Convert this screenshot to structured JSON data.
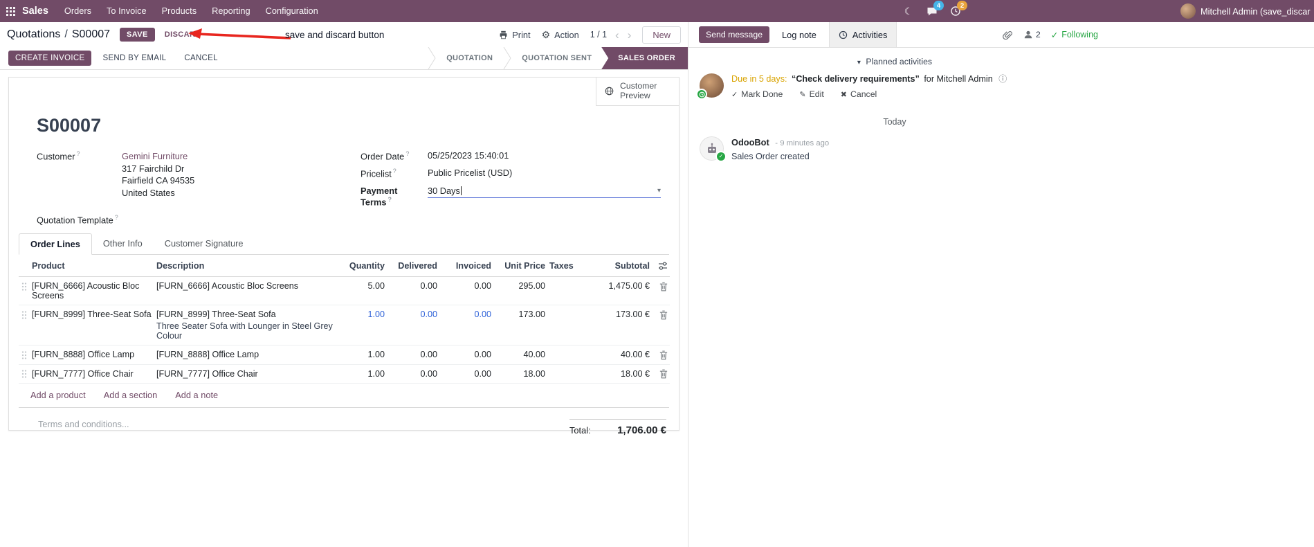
{
  "topbar": {
    "app_name": "Sales",
    "menus": [
      "Orders",
      "To Invoice",
      "Products",
      "Reporting",
      "Configuration"
    ],
    "chat_badge": "4",
    "activity_badge": "2",
    "user_name": "Mitchell Admin (save_discar"
  },
  "control_panel": {
    "breadcrumb_root": "Quotations",
    "breadcrumb_sep": "/",
    "breadcrumb_current": "S00007",
    "save": "SAVE",
    "discard": "DISCARD",
    "print": "Print",
    "action": "Action",
    "pager": "1 / 1",
    "new": "New"
  },
  "annotation": {
    "text": "save and discard button"
  },
  "statusbar": {
    "create_invoice": "CREATE INVOICE",
    "send_by_email": "SEND BY EMAIL",
    "cancel": "CANCEL",
    "stages": [
      "QUOTATION",
      "QUOTATION SENT",
      "SALES ORDER"
    ],
    "active_stage": "SALES ORDER"
  },
  "sheet": {
    "customer_preview": "Customer Preview",
    "title": "S00007",
    "fields": {
      "help_marker": "?",
      "customer_label": "Customer",
      "customer_name": "Gemini Furniture",
      "address_line1": "317 Fairchild Dr",
      "address_line2": "Fairfield CA 94535",
      "address_line3": "United States",
      "quotation_template_label": "Quotation Template",
      "order_date_label": "Order Date",
      "order_date_value": "05/25/2023 15:40:01",
      "pricelist_label": "Pricelist",
      "pricelist_value": "Public Pricelist (USD)",
      "payment_terms_label": "Payment Terms",
      "payment_terms_value": "30 Days"
    },
    "tabs": [
      "Order Lines",
      "Other Info",
      "Customer Signature"
    ],
    "active_tab": "Order Lines",
    "table": {
      "headers": [
        "Product",
        "Description",
        "Quantity",
        "Delivered",
        "Invoiced",
        "Unit Price",
        "Taxes",
        "Subtotal"
      ],
      "rows": [
        {
          "product": "[FURN_6666] Acoustic Bloc Screens",
          "description": "[FURN_6666] Acoustic Bloc Screens",
          "description2": "",
          "quantity": "5.00",
          "delivered": "0.00",
          "invoiced": "0.00",
          "unit_price": "295.00",
          "taxes": "",
          "subtotal": "1,475.00 €",
          "edited": false
        },
        {
          "product": "[FURN_8999] Three-Seat Sofa",
          "description": "[FURN_8999] Three-Seat Sofa",
          "description2": "Three Seater Sofa with Lounger in Steel Grey Colour",
          "quantity": "1.00",
          "delivered": "0.00",
          "invoiced": "0.00",
          "unit_price": "173.00",
          "taxes": "",
          "subtotal": "173.00 €",
          "edited": true
        },
        {
          "product": "[FURN_8888] Office Lamp",
          "description": "[FURN_8888] Office Lamp",
          "description2": "",
          "quantity": "1.00",
          "delivered": "0.00",
          "invoiced": "0.00",
          "unit_price": "40.00",
          "taxes": "",
          "subtotal": "40.00 €",
          "edited": false
        },
        {
          "product": "[FURN_7777] Office Chair",
          "description": "[FURN_7777] Office Chair",
          "description2": "",
          "quantity": "1.00",
          "delivered": "0.00",
          "invoiced": "0.00",
          "unit_price": "18.00",
          "taxes": "",
          "subtotal": "18.00 €",
          "edited": false
        }
      ],
      "add_links": [
        "Add a product",
        "Add a section",
        "Add a note"
      ]
    },
    "terms_placeholder": "Terms and conditions...",
    "total_label": "Total:",
    "total_value": "1,706.00 €"
  },
  "chatter": {
    "send_message": "Send message",
    "log_note": "Log note",
    "activities_tab": "Activities",
    "followers_count": "2",
    "following": "Following",
    "planned_header": "Planned activities",
    "activity": {
      "due": "Due in 5 days:",
      "summary": "“Check delivery requirements”",
      "assignee": "for Mitchell Admin",
      "mark_done": "Mark Done",
      "edit": "Edit",
      "cancel": "Cancel"
    },
    "date_divider": "Today",
    "message": {
      "author": "OdooBot",
      "timestamp": "- 9 minutes ago",
      "body": "Sales Order created"
    }
  },
  "icons": {
    "moon": "☾",
    "gear": "⚙",
    "caret_down": "▾",
    "chevron_left": "‹",
    "chevron_right": "›",
    "check": "✓",
    "pencil": "✎",
    "cross": "✖",
    "info": "ⓘ"
  },
  "colors": {
    "primary": "#714B67",
    "edited_value": "#2f62d8",
    "due_soon": "#d9a300",
    "following_green": "#28a745",
    "chat_badge": "#45b4e8",
    "activity_badge": "#e8a33d",
    "annotation_red": "#e8261f"
  }
}
